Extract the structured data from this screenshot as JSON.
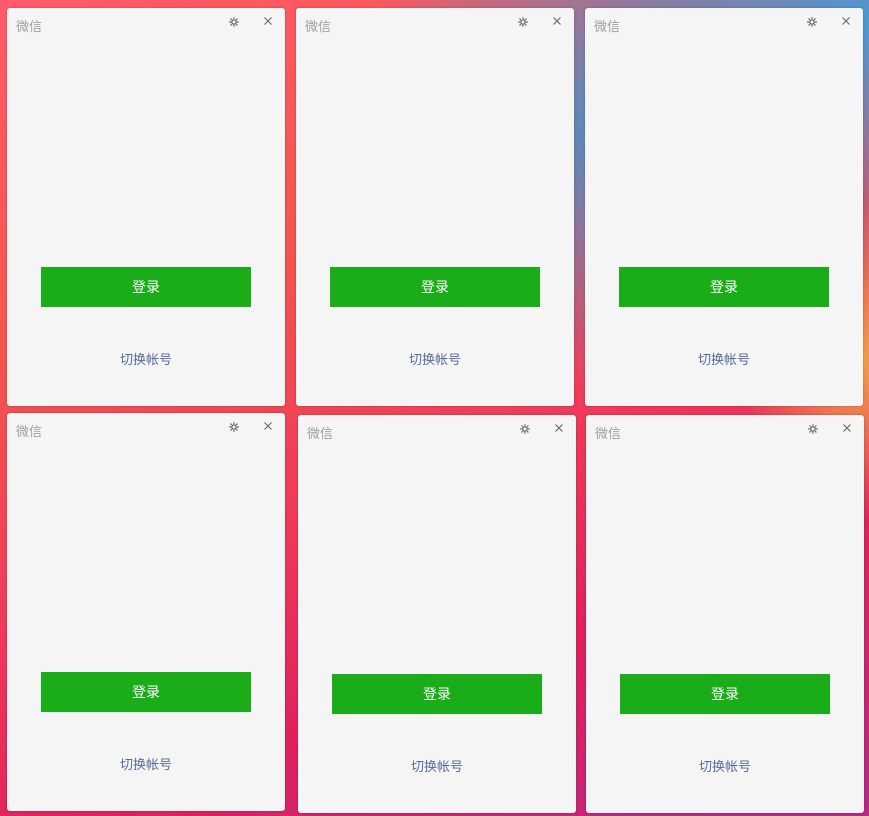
{
  "windows": [
    {
      "title": "微信",
      "login_label": "登录",
      "switch_label": "切换帐号",
      "settings_icon": "gear-icon",
      "close_icon": "close-icon"
    },
    {
      "title": "微信",
      "login_label": "登录",
      "switch_label": "切换帐号",
      "settings_icon": "gear-icon",
      "close_icon": "close-icon"
    },
    {
      "title": "微信",
      "login_label": "登录",
      "switch_label": "切换帐号",
      "settings_icon": "gear-icon",
      "close_icon": "close-icon"
    },
    {
      "title": "微信",
      "login_label": "登录",
      "switch_label": "切换帐号",
      "settings_icon": "gear-icon",
      "close_icon": "close-icon"
    },
    {
      "title": "微信",
      "login_label": "登录",
      "switch_label": "切换帐号",
      "settings_icon": "gear-icon",
      "close_icon": "close-icon"
    },
    {
      "title": "微信",
      "login_label": "登录",
      "switch_label": "切换帐号",
      "settings_icon": "gear-icon",
      "close_icon": "close-icon"
    }
  ],
  "colors": {
    "login_button": "#1aad19",
    "switch_link": "#576b95",
    "window_bg": "#f5f5f5"
  }
}
